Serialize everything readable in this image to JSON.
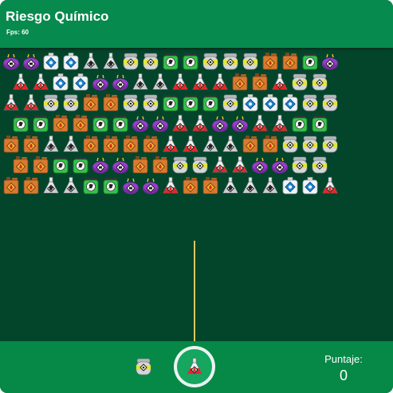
{
  "header": {
    "title": "Riesgo Químico",
    "fps": "Fps: 60"
  },
  "score": {
    "label": "Puntaje:",
    "value": "0"
  },
  "shooter": {
    "current_piece": "red-flask",
    "next_piece": "gray-canister"
  },
  "pieces": {
    "purple-bag": {
      "icon": "corrosive-purple-bag-icon"
    },
    "blue-bottle": {
      "icon": "explosive-blue-bottle-icon"
    },
    "gray-flask": {
      "icon": "environment-gray-flask-icon"
    },
    "gray-canister": {
      "icon": "irritant-gray-canister-icon"
    },
    "green-jar": {
      "icon": "toxic-green-jar-icon"
    },
    "orange-jug": {
      "icon": "flammable-orange-jug-icon"
    },
    "red-flask": {
      "icon": "flammable-red-flask-icon"
    }
  },
  "grid": {
    "rows": [
      [
        "purple-bag",
        "purple-bag",
        "blue-bottle",
        "blue-bottle",
        "gray-flask",
        "gray-flask",
        "gray-canister",
        "gray-canister",
        "green-jar",
        "green-jar",
        "gray-canister",
        "gray-canister",
        "gray-canister",
        "orange-jug",
        "orange-jug",
        "green-jar",
        "purple-bag"
      ],
      [
        "red-flask",
        "red-flask",
        "blue-bottle",
        "blue-bottle",
        "purple-bag",
        "purple-bag",
        "gray-flask",
        "gray-flask",
        "red-flask",
        "red-flask",
        "red-flask",
        "orange-jug",
        "orange-jug",
        "red-flask",
        "gray-canister",
        "gray-canister"
      ],
      [
        "red-flask",
        "red-flask",
        "gray-canister",
        "gray-canister",
        "orange-jug",
        "orange-jug",
        "gray-canister",
        "gray-canister",
        "green-jar",
        "green-jar",
        "green-jar",
        "gray-canister",
        "blue-bottle",
        "blue-bottle",
        "blue-bottle",
        "gray-canister",
        "gray-canister"
      ],
      [
        "green-jar",
        "green-jar",
        "orange-jug",
        "orange-jug",
        "green-jar",
        "green-jar",
        "purple-bag",
        "purple-bag",
        "red-flask",
        "red-flask",
        "purple-bag",
        "purple-bag",
        "red-flask",
        "red-flask",
        "green-jar",
        "green-jar"
      ],
      [
        "orange-jug",
        "orange-jug",
        "gray-flask",
        "gray-flask",
        "orange-jug",
        "orange-jug",
        "orange-jug",
        "orange-jug",
        "red-flask",
        "red-flask",
        "gray-flask",
        "gray-flask",
        "orange-jug",
        "orange-jug",
        "gray-canister",
        "gray-canister",
        "gray-canister"
      ],
      [
        "orange-jug",
        "orange-jug",
        "green-jar",
        "green-jar",
        "purple-bag",
        "purple-bag",
        "orange-jug",
        "orange-jug",
        "gray-canister",
        "gray-canister",
        "red-flask",
        "red-flask",
        "purple-bag",
        "purple-bag",
        "gray-canister",
        "gray-canister"
      ],
      [
        "orange-jug",
        "orange-jug",
        "gray-flask",
        "gray-flask",
        "green-jar",
        "green-jar",
        "purple-bag",
        "purple-bag",
        "red-flask",
        "orange-jug",
        "orange-jug",
        "gray-flask",
        "gray-flask",
        "gray-flask",
        "blue-bottle",
        "blue-bottle",
        "red-flask"
      ]
    ]
  }
}
